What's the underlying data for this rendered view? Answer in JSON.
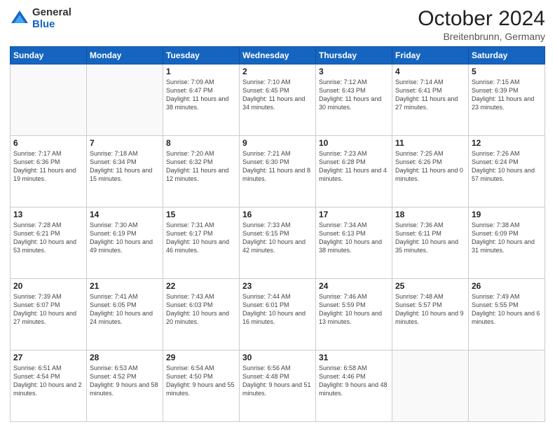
{
  "logo": {
    "general": "General",
    "blue": "Blue"
  },
  "header": {
    "month": "October 2024",
    "location": "Breitenbrunn, Germany"
  },
  "weekdays": [
    "Sunday",
    "Monday",
    "Tuesday",
    "Wednesday",
    "Thursday",
    "Friday",
    "Saturday"
  ],
  "weeks": [
    [
      {
        "day": "",
        "info": ""
      },
      {
        "day": "",
        "info": ""
      },
      {
        "day": "1",
        "info": "Sunrise: 7:09 AM\nSunset: 6:47 PM\nDaylight: 11 hours and 38 minutes."
      },
      {
        "day": "2",
        "info": "Sunrise: 7:10 AM\nSunset: 6:45 PM\nDaylight: 11 hours and 34 minutes."
      },
      {
        "day": "3",
        "info": "Sunrise: 7:12 AM\nSunset: 6:43 PM\nDaylight: 11 hours and 30 minutes."
      },
      {
        "day": "4",
        "info": "Sunrise: 7:14 AM\nSunset: 6:41 PM\nDaylight: 11 hours and 27 minutes."
      },
      {
        "day": "5",
        "info": "Sunrise: 7:15 AM\nSunset: 6:39 PM\nDaylight: 11 hours and 23 minutes."
      }
    ],
    [
      {
        "day": "6",
        "info": "Sunrise: 7:17 AM\nSunset: 6:36 PM\nDaylight: 11 hours and 19 minutes."
      },
      {
        "day": "7",
        "info": "Sunrise: 7:18 AM\nSunset: 6:34 PM\nDaylight: 11 hours and 15 minutes."
      },
      {
        "day": "8",
        "info": "Sunrise: 7:20 AM\nSunset: 6:32 PM\nDaylight: 11 hours and 12 minutes."
      },
      {
        "day": "9",
        "info": "Sunrise: 7:21 AM\nSunset: 6:30 PM\nDaylight: 11 hours and 8 minutes."
      },
      {
        "day": "10",
        "info": "Sunrise: 7:23 AM\nSunset: 6:28 PM\nDaylight: 11 hours and 4 minutes."
      },
      {
        "day": "11",
        "info": "Sunrise: 7:25 AM\nSunset: 6:26 PM\nDaylight: 11 hours and 0 minutes."
      },
      {
        "day": "12",
        "info": "Sunrise: 7:26 AM\nSunset: 6:24 PM\nDaylight: 10 hours and 57 minutes."
      }
    ],
    [
      {
        "day": "13",
        "info": "Sunrise: 7:28 AM\nSunset: 6:21 PM\nDaylight: 10 hours and 53 minutes."
      },
      {
        "day": "14",
        "info": "Sunrise: 7:30 AM\nSunset: 6:19 PM\nDaylight: 10 hours and 49 minutes."
      },
      {
        "day": "15",
        "info": "Sunrise: 7:31 AM\nSunset: 6:17 PM\nDaylight: 10 hours and 46 minutes."
      },
      {
        "day": "16",
        "info": "Sunrise: 7:33 AM\nSunset: 6:15 PM\nDaylight: 10 hours and 42 minutes."
      },
      {
        "day": "17",
        "info": "Sunrise: 7:34 AM\nSunset: 6:13 PM\nDaylight: 10 hours and 38 minutes."
      },
      {
        "day": "18",
        "info": "Sunrise: 7:36 AM\nSunset: 6:11 PM\nDaylight: 10 hours and 35 minutes."
      },
      {
        "day": "19",
        "info": "Sunrise: 7:38 AM\nSunset: 6:09 PM\nDaylight: 10 hours and 31 minutes."
      }
    ],
    [
      {
        "day": "20",
        "info": "Sunrise: 7:39 AM\nSunset: 6:07 PM\nDaylight: 10 hours and 27 minutes."
      },
      {
        "day": "21",
        "info": "Sunrise: 7:41 AM\nSunset: 6:05 PM\nDaylight: 10 hours and 24 minutes."
      },
      {
        "day": "22",
        "info": "Sunrise: 7:43 AM\nSunset: 6:03 PM\nDaylight: 10 hours and 20 minutes."
      },
      {
        "day": "23",
        "info": "Sunrise: 7:44 AM\nSunset: 6:01 PM\nDaylight: 10 hours and 16 minutes."
      },
      {
        "day": "24",
        "info": "Sunrise: 7:46 AM\nSunset: 5:59 PM\nDaylight: 10 hours and 13 minutes."
      },
      {
        "day": "25",
        "info": "Sunrise: 7:48 AM\nSunset: 5:57 PM\nDaylight: 10 hours and 9 minutes."
      },
      {
        "day": "26",
        "info": "Sunrise: 7:49 AM\nSunset: 5:55 PM\nDaylight: 10 hours and 6 minutes."
      }
    ],
    [
      {
        "day": "27",
        "info": "Sunrise: 6:51 AM\nSunset: 4:54 PM\nDaylight: 10 hours and 2 minutes."
      },
      {
        "day": "28",
        "info": "Sunrise: 6:53 AM\nSunset: 4:52 PM\nDaylight: 9 hours and 58 minutes."
      },
      {
        "day": "29",
        "info": "Sunrise: 6:54 AM\nSunset: 4:50 PM\nDaylight: 9 hours and 55 minutes."
      },
      {
        "day": "30",
        "info": "Sunrise: 6:56 AM\nSunset: 4:48 PM\nDaylight: 9 hours and 51 minutes."
      },
      {
        "day": "31",
        "info": "Sunrise: 6:58 AM\nSunset: 4:46 PM\nDaylight: 9 hours and 48 minutes."
      },
      {
        "day": "",
        "info": ""
      },
      {
        "day": "",
        "info": ""
      }
    ]
  ]
}
